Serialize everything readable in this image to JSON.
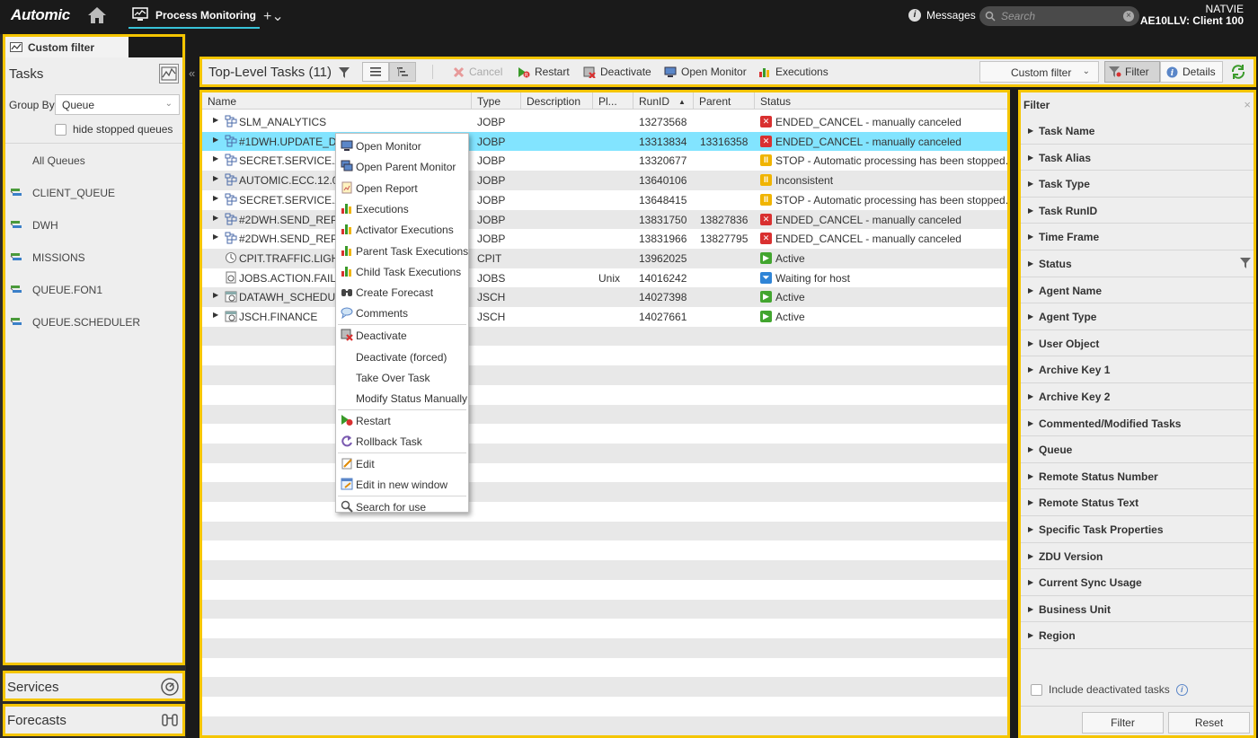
{
  "app": {
    "logo": "Automic",
    "active_tab": "Process Monitoring",
    "add_tab": "+⌄"
  },
  "topbar": {
    "messages_label": "Messages",
    "search_placeholder": "Search",
    "user": "NATVIE",
    "client": "AE10LLV: Client 100"
  },
  "left_panel": {
    "tab_label": "Custom filter",
    "title": "Tasks",
    "group_by_label": "Group By",
    "group_by_value": "Queue",
    "hide_stopped_label": "hide stopped queues",
    "queues": [
      {
        "label": "All Queues",
        "icon": ""
      },
      {
        "label": "CLIENT_QUEUE",
        "icon": "queue-icon"
      },
      {
        "label": "DWH",
        "icon": "queue-icon"
      },
      {
        "label": "MISSIONS",
        "icon": "queue-icon"
      },
      {
        "label": "QUEUE.FON1",
        "icon": "queue-icon"
      },
      {
        "label": "QUEUE.SCHEDULER",
        "icon": "queue-icon"
      }
    ],
    "services_label": "Services",
    "forecasts_label": "Forecasts"
  },
  "toolbar": {
    "title": "Top-Level Tasks (11)",
    "cancel": "Cancel",
    "restart": "Restart",
    "deactivate": "Deactivate",
    "open_monitor": "Open Monitor",
    "executions": "Executions",
    "custom_filter": "Custom filter",
    "filter": "Filter",
    "details": "Details"
  },
  "grid": {
    "columns": {
      "name": "Name",
      "type": "Type",
      "description": "Description",
      "platform": "Pl...",
      "runid": "RunID",
      "parent": "Parent",
      "status": "Status"
    },
    "rows": [
      {
        "name": "SLM_ANALYTICS",
        "type": "JOBP",
        "platform": "",
        "runid": "13273568",
        "parent": "",
        "status": "ENDED_CANCEL - manually canceled",
        "status_kind": "red",
        "expandable": true,
        "icon": "workflow-icon"
      },
      {
        "name": "#1DWH.UPDATE_DAT",
        "type": "JOBP",
        "platform": "",
        "runid": "13313834",
        "parent": "13316358",
        "status": "ENDED_CANCEL - manually canceled",
        "status_kind": "red",
        "expandable": true,
        "icon": "workflow-icon"
      },
      {
        "name": "SECRET.SERVICE.AC",
        "type": "JOBP",
        "platform": "",
        "runid": "13320677",
        "parent": "",
        "status": "STOP - Automatic processing has been stopped.",
        "status_kind": "yellow",
        "expandable": true,
        "icon": "workflow-icon"
      },
      {
        "name": "AUTOMIC.ECC.12.0.0",
        "type": "JOBP",
        "platform": "",
        "runid": "13640106",
        "parent": "",
        "status": "Inconsistent",
        "status_kind": "yellow",
        "expandable": true,
        "icon": "workflow-icon"
      },
      {
        "name": "SECRET.SERVICE.AC",
        "type": "JOBP",
        "platform": "",
        "runid": "13648415",
        "parent": "",
        "status": "STOP - Automatic processing has been stopped.",
        "status_kind": "yellow",
        "expandable": true,
        "icon": "workflow-icon"
      },
      {
        "name": "#2DWH.SEND_REPO",
        "type": "JOBP",
        "platform": "",
        "runid": "13831750",
        "parent": "13827836",
        "status": "ENDED_CANCEL - manually canceled",
        "status_kind": "red",
        "expandable": true,
        "icon": "workflow-icon"
      },
      {
        "name": "#2DWH.SEND_REPO",
        "type": "JOBP",
        "platform": "",
        "runid": "13831966",
        "parent": "13827795",
        "status": "ENDED_CANCEL - manually canceled",
        "status_kind": "red",
        "expandable": true,
        "icon": "workflow-icon"
      },
      {
        "name": "CPIT.TRAFFIC.LIGHTS",
        "type": "CPIT",
        "platform": "",
        "runid": "13962025",
        "parent": "",
        "status": "Active",
        "status_kind": "green",
        "expandable": false,
        "icon": "cpit-icon"
      },
      {
        "name": "JOBS.ACTION.FAIL",
        "type": "JOBS",
        "platform": "Unix",
        "runid": "14016242",
        "parent": "",
        "status": "Waiting for host",
        "status_kind": "blue",
        "expandable": false,
        "icon": "job-icon"
      },
      {
        "name": "DATAWH_SCHEDULE",
        "type": "JSCH",
        "platform": "",
        "runid": "14027398",
        "parent": "",
        "status": "Active",
        "status_kind": "green",
        "expandable": true,
        "icon": "schedule-icon"
      },
      {
        "name": "JSCH.FINANCE",
        "type": "JSCH",
        "platform": "",
        "runid": "14027661",
        "parent": "",
        "status": "Active",
        "status_kind": "green",
        "expandable": true,
        "icon": "schedule-icon"
      }
    ]
  },
  "context_menu": [
    {
      "label": "Open Monitor",
      "icon": "monitor-icon"
    },
    {
      "label": "Open Parent Monitor",
      "icon": "parent-monitor-icon"
    },
    {
      "label": "Open Report",
      "icon": "report-icon"
    },
    {
      "label": "Executions",
      "icon": "executions-icon"
    },
    {
      "label": "Activator Executions",
      "icon": "executions-icon"
    },
    {
      "label": "Parent Task Executions",
      "icon": "executions-icon"
    },
    {
      "label": "Child Task Executions",
      "icon": "executions-icon"
    },
    {
      "label": "Create Forecast",
      "icon": "binoculars-icon"
    },
    {
      "label": "Comments",
      "icon": "comment-icon"
    },
    {
      "label": "Deactivate",
      "icon": "deactivate-icon"
    },
    {
      "label": "Deactivate (forced)",
      "icon": ""
    },
    {
      "label": "Take Over Task",
      "icon": ""
    },
    {
      "label": "Modify Status Manually",
      "icon": ""
    },
    {
      "label": "Restart",
      "icon": "restart-icon"
    },
    {
      "label": "Rollback Task",
      "icon": "rollback-icon"
    },
    {
      "label": "Edit",
      "icon": "edit-icon"
    },
    {
      "label": "Edit in new window",
      "icon": "edit-window-icon"
    },
    {
      "label": "Search for use",
      "icon": "search-icon"
    }
  ],
  "filter_panel": {
    "title": "Filter",
    "items": [
      "Task Name",
      "Task Alias",
      "Task Type",
      "Task RunID",
      "Time Frame",
      "Status",
      "Agent Name",
      "Agent Type",
      "User Object",
      "Archive Key 1",
      "Archive Key 2",
      "Commented/Modified Tasks",
      "Queue",
      "Remote Status Number",
      "Remote Status Text",
      "Specific Task Properties",
      "ZDU Version",
      "Current Sync Usage",
      "Business Unit",
      "Region"
    ],
    "include_deactivated_label": "Include deactivated tasks",
    "filter_button": "Filter",
    "reset_button": "Reset"
  },
  "colors": {
    "highlight_border": "#f5c500",
    "selected_row": "#82e4ff",
    "accent_tab": "#38c3d8"
  }
}
